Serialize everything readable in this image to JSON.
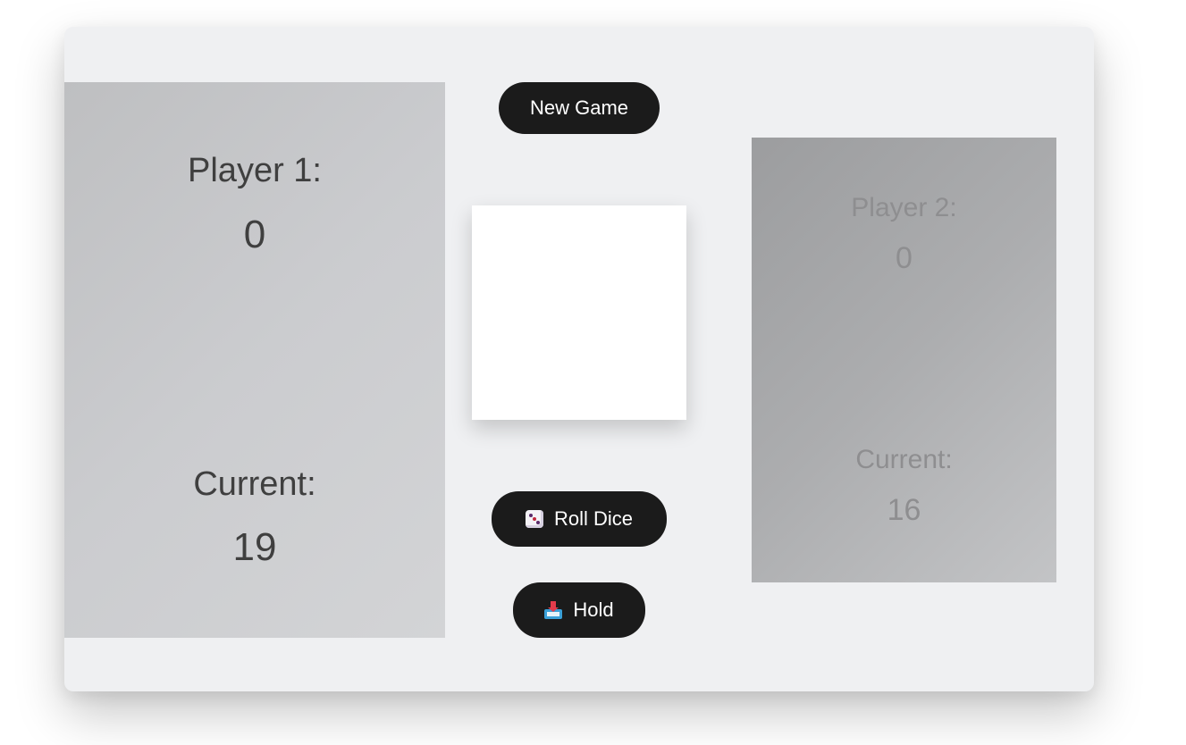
{
  "player1": {
    "name": "Player 1:",
    "score": "0",
    "current_label": "Current:",
    "current_score": "19"
  },
  "player2": {
    "name": "Player 2:",
    "score": "0",
    "current_label": "Current:",
    "current_score": "16"
  },
  "controls": {
    "new_game_label": "New Game",
    "roll_dice_label": "Roll Dice",
    "roll_dice_icon": "dice-icon",
    "hold_label": "Hold",
    "hold_icon": "inbox-tray-icon"
  },
  "colors": {
    "button_bg": "#1b1b1b",
    "board_bg": "#eff0f2"
  }
}
